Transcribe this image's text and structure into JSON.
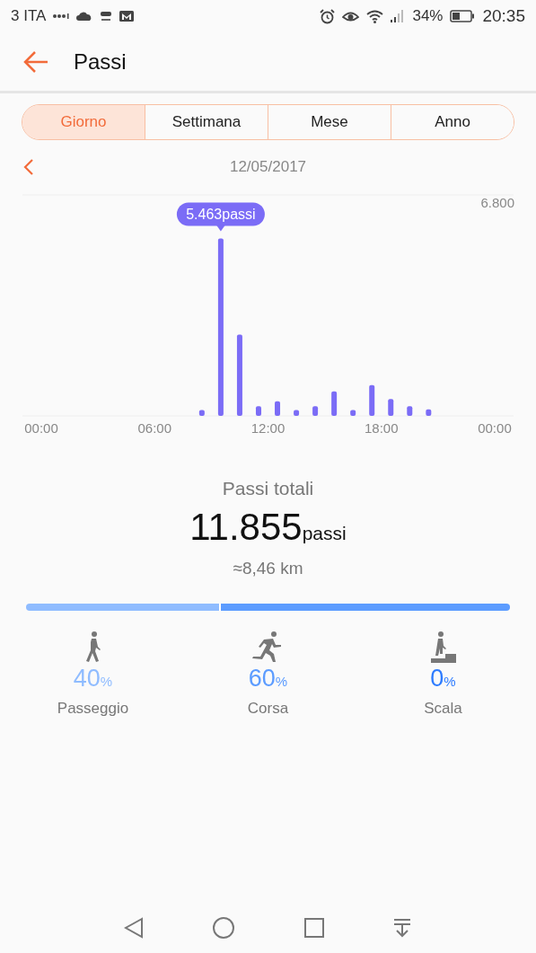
{
  "status_bar": {
    "carrier": "3 ITA",
    "battery": "34%",
    "time": "20:35"
  },
  "header": {
    "title": "Passi"
  },
  "tabs": [
    {
      "label": "Giorno",
      "selected": true
    },
    {
      "label": "Settimana",
      "selected": false
    },
    {
      "label": "Mese",
      "selected": false
    },
    {
      "label": "Anno",
      "selected": false
    }
  ],
  "date": "12/05/2017",
  "chart_data": {
    "type": "bar",
    "x": [
      8.5,
      9.5,
      10.5,
      11.5,
      12.5,
      13.5,
      14.5,
      15.5,
      16.5,
      17.5,
      18.5,
      19.5,
      20.5
    ],
    "series": [
      {
        "color": "#7b6cf6",
        "values": [
          180,
          5460,
          2500,
          300,
          450,
          180,
          300,
          750,
          180,
          950,
          520,
          300,
          200
        ]
      }
    ],
    "xlim": [
      -1,
      25
    ],
    "ylim": [
      0,
      6800
    ],
    "xticks": [
      {
        "value": 0,
        "label": "00:00"
      },
      {
        "value": 6,
        "label": "06:00"
      },
      {
        "value": 12,
        "label": "12:00"
      },
      {
        "value": 18,
        "label": "18:00"
      },
      {
        "value": 24,
        "label": "00:00"
      }
    ],
    "yticks": [
      {
        "value": 6800,
        "label": "6.800"
      }
    ],
    "annotations": [
      "5.463passi"
    ]
  },
  "summary": {
    "label": "Passi totali",
    "value": "11.855",
    "unit": "passi",
    "distance": "≈8,46 km"
  },
  "activities": [
    {
      "kind": "walk",
      "name": "Passeggio",
      "percent": "40",
      "unit": "%",
      "level": 0.4,
      "color": "#8fbcff"
    },
    {
      "kind": "run",
      "name": "Corsa",
      "percent": "60",
      "unit": "%",
      "level": 0.6,
      "color": "#5c9cff"
    },
    {
      "kind": "stairs",
      "name": "Scala",
      "percent": "0",
      "unit": "%",
      "color": "#2e7cff"
    }
  ]
}
